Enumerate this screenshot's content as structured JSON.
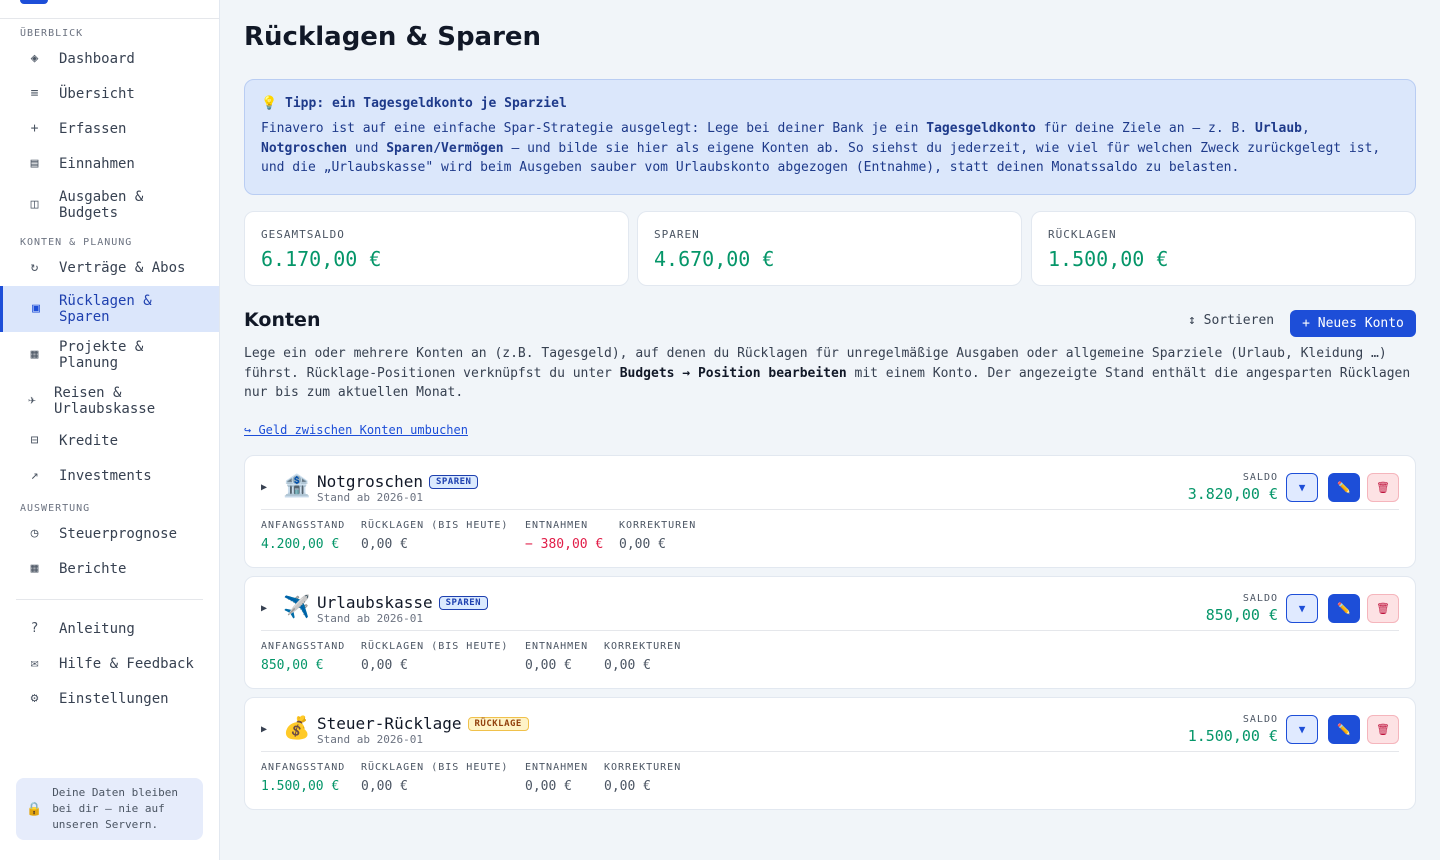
{
  "sidebar": {
    "sections": [
      {
        "title": "ÜBERBLICK"
      },
      {
        "title": "KONTEN & PLANUNG"
      },
      {
        "title": "AUSWERTUNG"
      }
    ],
    "items": [
      {
        "label": "Dashboard",
        "icon": "◈"
      },
      {
        "label": "Übersicht",
        "icon": "≡"
      },
      {
        "label": "Erfassen",
        "icon": "+"
      },
      {
        "label": "Einnahmen",
        "icon": "▤"
      },
      {
        "label": "Ausgaben & Budgets",
        "icon": "◫"
      },
      {
        "label": "Verträge & Abos",
        "icon": "↻"
      },
      {
        "label": "Rücklagen & Sparen",
        "icon": "▣"
      },
      {
        "label": "Projekte & Planung",
        "icon": "▦"
      },
      {
        "label": "Reisen & Urlaubskasse",
        "icon": "✈"
      },
      {
        "label": "Kredite",
        "icon": "⊟"
      },
      {
        "label": "Investments",
        "icon": "↗"
      },
      {
        "label": "Steuerprognose",
        "icon": "◷"
      },
      {
        "label": "Berichte",
        "icon": "▦"
      },
      {
        "label": "Anleitung",
        "icon": "?"
      },
      {
        "label": "Hilfe & Feedback",
        "icon": "✉"
      },
      {
        "label": "Einstellungen",
        "icon": "⚙"
      }
    ],
    "privacy": {
      "icon": "🔒",
      "text": "Deine Daten bleiben bei dir – nie auf unseren Servern."
    }
  },
  "page": {
    "title": "Rücklagen & Sparen"
  },
  "tip": {
    "title": "💡 Tipp: ein Tagesgeldkonto je Sparziel",
    "t1": "Finavero ist auf eine einfache Spar-Strategie ausgelegt: Lege bei deiner Bank je ein ",
    "b1": "Tagesgeldkonto",
    "t2": " für deine Ziele an – z. B. ",
    "b2": "Urlaub",
    "t3": ", ",
    "b3": "Notgroschen",
    "t4": " und ",
    "b4": "Sparen/Vermögen",
    "t5": " – und bilde sie hier als eigene Konten ab. So siehst du jederzeit, wie viel für welchen Zweck zurückgelegt ist, und die „Urlaubskasse\" wird beim Ausgeben sauber vom Urlaubskonto abgezogen (Entnahme), statt deinen Monatssaldo zu belasten."
  },
  "stats": [
    {
      "label": "GESAMTSALDO",
      "value": "6.170,00 €"
    },
    {
      "label": "SPAREN",
      "value": "4.670,00 €"
    },
    {
      "label": "RÜCKLAGEN",
      "value": "1.500,00 €"
    }
  ],
  "accounts_section": {
    "title": "Konten",
    "sort_label": "↕ Sortieren",
    "new_label": "+ Neues Konto",
    "d1": "Lege ein oder mehrere Konten an (z.B. Tagesgeld), auf denen du Rücklagen für unregelmäßige Ausgaben oder allgemeine Sparziele (Urlaub, Kleidung …) führst. Rücklage-Positionen verknüpfst du unter ",
    "d2": "Budgets → Position bearbeiten",
    "d3": " mit einem Konto. Der angezeigte Stand enthält die angesparten Rücklagen nur bis zum aktuellen Monat.",
    "transfer": "↪ Geld zwischen Konten umbuchen"
  },
  "columns": {
    "start": "ANFANGSSTAND",
    "reserves": "RÜCKLAGEN (BIS HEUTE)",
    "withdrawals": "ENTNAHMEN",
    "corrections": "KORREKTUREN",
    "saldo": "SALDO"
  },
  "accounts": [
    {
      "emoji": "🏦",
      "name": "Notgroschen",
      "badge": "SPAREN",
      "stand": "Stand ab 2026-01",
      "saldo": "3.820,00 €",
      "start": "4.200,00 €",
      "reserves": "0,00 €",
      "withdrawals": "− 380,00 €",
      "corrections": "0,00 €"
    },
    {
      "emoji": "✈️",
      "name": "Urlaubskasse",
      "badge": "SPAREN",
      "stand": "Stand ab 2026-01",
      "saldo": "850,00 €",
      "start": "850,00 €",
      "reserves": "0,00 €",
      "withdrawals": "0,00 €",
      "corrections": "0,00 €"
    },
    {
      "emoji": "💰",
      "name": "Steuer-Rücklage",
      "badge": "RÜCKLAGE",
      "stand": "Stand ab 2026-01",
      "saldo": "1.500,00 €",
      "start": "1.500,00 €",
      "reserves": "0,00 €",
      "withdrawals": "0,00 €",
      "corrections": "0,00 €"
    }
  ],
  "icons": {
    "expand": "▼",
    "edit": "✏️",
    "delete": "🗑",
    "caret": "▶"
  },
  "colors": {
    "accent": "#1d4ed8",
    "positive": "#059669",
    "negative": "#e11d48",
    "tip_bg": "#dbe7fb"
  }
}
